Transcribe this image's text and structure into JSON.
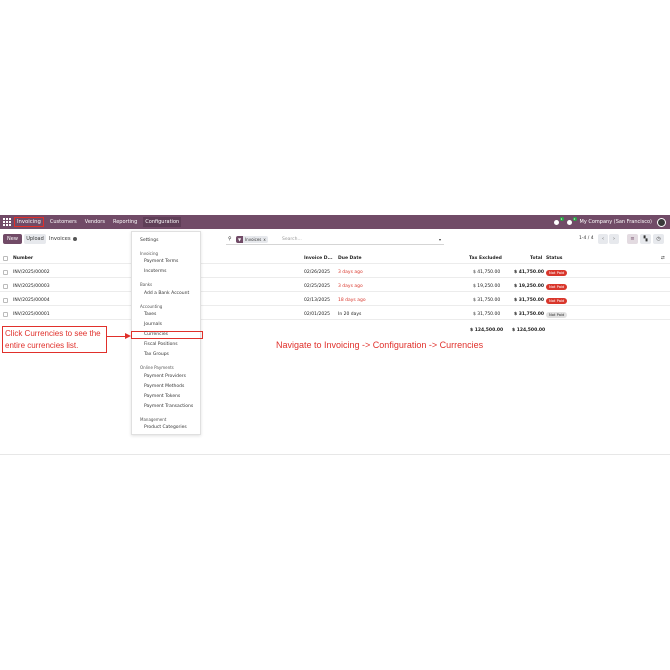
{
  "navbar": {
    "brand": "Invoicing",
    "items": [
      "Customers",
      "Vendors",
      "Reporting",
      "Configuration"
    ],
    "activity_count": "1",
    "notif_count": "2",
    "company": "My Company (San Francisco)"
  },
  "control_panel": {
    "new_label": "New",
    "upload_label": "Upload",
    "breadcrumb": "Invoices",
    "facet_label": "Invoices",
    "facet_remove": "x",
    "search_placeholder": "Search...",
    "pager": "1-4 / 4"
  },
  "table": {
    "headers": {
      "number": "Number",
      "invoice_date": "Invoice D...",
      "due_date": "Due Date",
      "tax_excluded": "Tax Excluded",
      "total": "Total",
      "status": "Status"
    },
    "rows": [
      {
        "number": "INV/2025/00002",
        "invoice_date": "02/26/2025",
        "due_date": "3 days ago",
        "tax_excluded": "$ 41,750.00",
        "total": "$ 41,750.00",
        "status": "Not Paid"
      },
      {
        "number": "INV/2025/00003",
        "invoice_date": "02/25/2025",
        "due_date": "3 days ago",
        "tax_excluded": "$ 19,250.00",
        "total": "$ 19,250.00",
        "status": "Not Paid"
      },
      {
        "number": "INV/2025/00004",
        "invoice_date": "02/13/2025",
        "due_date": "18 days ago",
        "tax_excluded": "$ 31,750.00",
        "total": "$ 31,750.00",
        "status": "Not Paid"
      },
      {
        "number": "INV/2025/00001",
        "invoice_date": "02/01/2025",
        "due_date": "In 20 days",
        "tax_excluded": "$ 31,750.00",
        "total": "$ 31,750.00",
        "status": "Not Paid"
      }
    ],
    "sum_tax_excluded": "$ 124,500.00",
    "sum_total": "$ 124,500.00"
  },
  "dropdown": {
    "settings": "Settings",
    "sections": [
      {
        "header": "Invoicing",
        "items": [
          "Payment Terms",
          "Incoterms"
        ]
      },
      {
        "header": "Banks",
        "items": [
          "Add a Bank Account"
        ]
      },
      {
        "header": "Accounting",
        "items": [
          "Taxes",
          "Journals",
          "Currencies",
          "Fiscal Positions",
          "Tax Groups"
        ]
      },
      {
        "header": "Online Payments",
        "items": [
          "Payment Providers",
          "Payment Methods",
          "Payment Tokens",
          "Payment Transactions"
        ]
      },
      {
        "header": "Management",
        "items": [
          "Product Categories"
        ]
      }
    ]
  },
  "annotations": {
    "click_note": "Click Currencies to see the entire currencies list.",
    "nav_note": "Navigate to Invoicing -> Configuration -> Currencies"
  },
  "colors": {
    "brand": "#714b67",
    "annotation": "#e0302b",
    "danger": "#d9362b"
  }
}
